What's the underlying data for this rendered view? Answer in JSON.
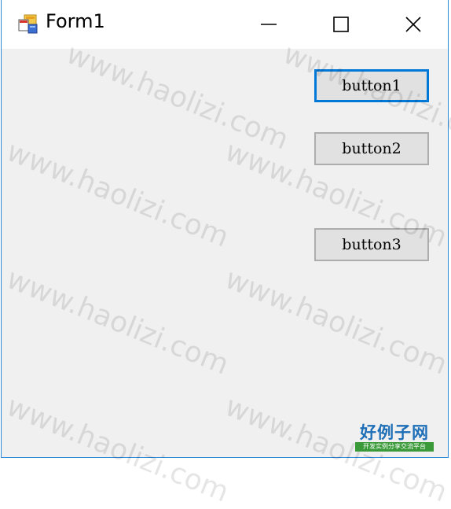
{
  "window": {
    "title": "Form1",
    "title_icon": "winforms-app-icon",
    "caption_buttons": [
      "minimize-icon",
      "maximize-icon",
      "close-icon"
    ]
  },
  "buttons": [
    {
      "label": "button1",
      "focused": true
    },
    {
      "label": "button2",
      "focused": false
    },
    {
      "label": "button3",
      "focused": false
    }
  ],
  "watermark": {
    "text": "www.haolizi.com"
  },
  "logo": {
    "title": "好例子网",
    "subtitle": "开发实例分享交流平台"
  },
  "colors": {
    "window_border": "#2b87d9",
    "client_bg": "#f0f0f0",
    "button_bg": "#e1e1e1",
    "button_border": "#adadad",
    "focus_border": "#0078d7",
    "logo_blue": "#1e6fb7",
    "logo_green": "#3a9a3a"
  }
}
